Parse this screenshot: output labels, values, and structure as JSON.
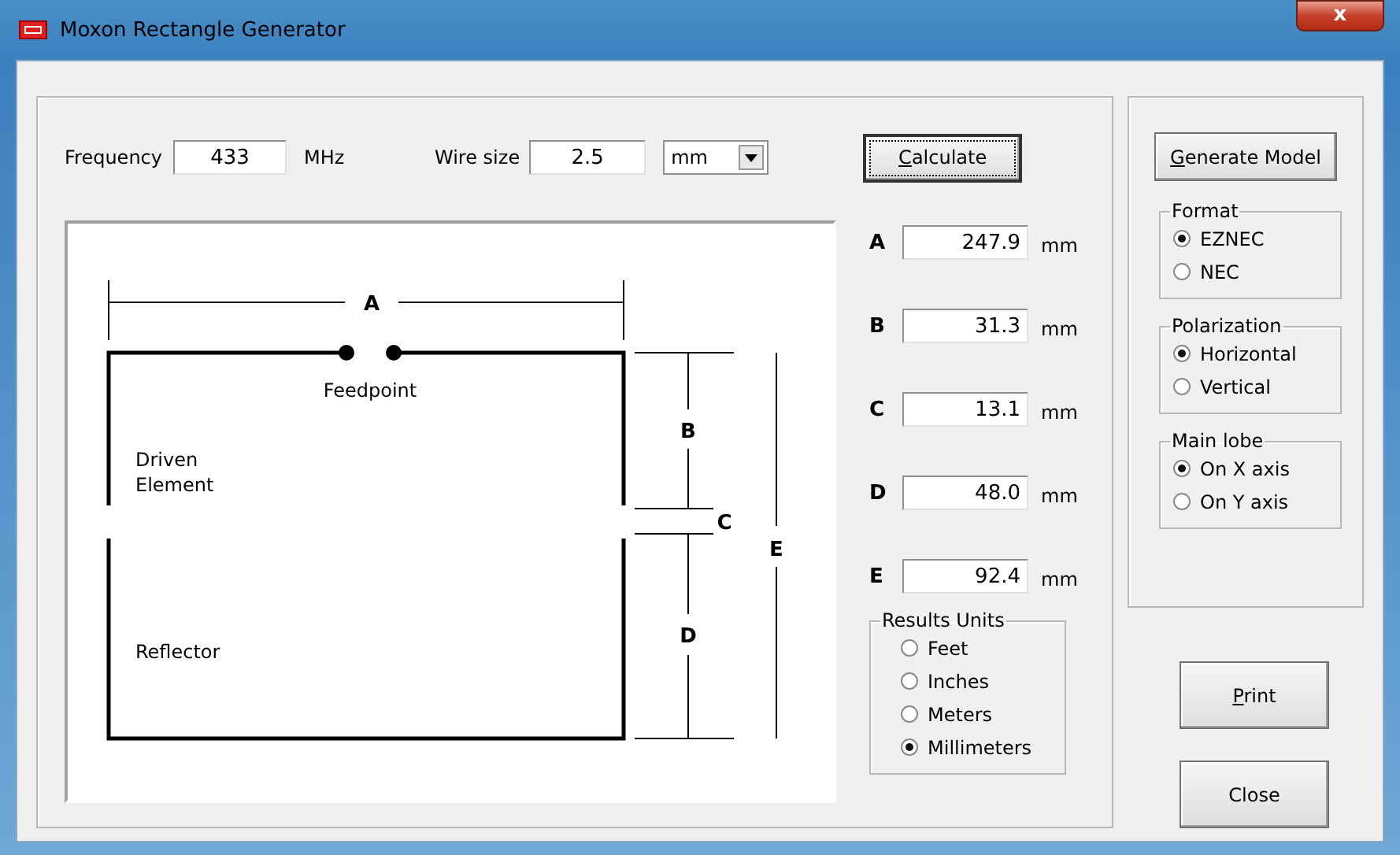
{
  "window": {
    "title": "Moxon Rectangle Generator",
    "close": "x"
  },
  "inputs": {
    "frequency": {
      "label": "Frequency",
      "value": "433",
      "unit": "MHz"
    },
    "wire_size": {
      "label": "Wire size",
      "value": "2.5",
      "unit": "mm"
    }
  },
  "calculate_button": {
    "label": "Calculate",
    "accel": true
  },
  "diagram": {
    "labels": {
      "a": "A",
      "b": "B",
      "c": "C",
      "d": "D",
      "e": "E",
      "feedpoint": "Feedpoint",
      "driven_1": "Driven",
      "driven_2": "Element",
      "reflector": "Reflector"
    }
  },
  "results": [
    {
      "letter": "A",
      "value": "247.9",
      "unit": "mm"
    },
    {
      "letter": "B",
      "value": "31.3",
      "unit": "mm"
    },
    {
      "letter": "C",
      "value": "13.1",
      "unit": "mm"
    },
    {
      "letter": "D",
      "value": "48.0",
      "unit": "mm"
    },
    {
      "letter": "E",
      "value": "92.4",
      "unit": "mm"
    }
  ],
  "results_units": {
    "title": "Results Units",
    "options": [
      {
        "label": "Feet",
        "selected": false
      },
      {
        "label": "Inches",
        "selected": false
      },
      {
        "label": "Meters",
        "selected": false
      },
      {
        "label": "Millimeters",
        "selected": true
      }
    ]
  },
  "generate_button": {
    "label": "Generate Model",
    "accel": true
  },
  "groups": [
    {
      "title": "Format",
      "options": [
        {
          "label": "EZNEC",
          "selected": true
        },
        {
          "label": "NEC",
          "selected": false
        }
      ]
    },
    {
      "title": "Polarization",
      "options": [
        {
          "label": "Horizontal",
          "selected": true
        },
        {
          "label": "Vertical",
          "selected": false
        }
      ]
    },
    {
      "title": "Main lobe",
      "options": [
        {
          "label": "On X axis",
          "selected": true
        },
        {
          "label": "On Y axis",
          "selected": false
        }
      ]
    }
  ],
  "print_button": {
    "label": "Print",
    "accel": true
  },
  "close_button": {
    "label": "Close"
  }
}
